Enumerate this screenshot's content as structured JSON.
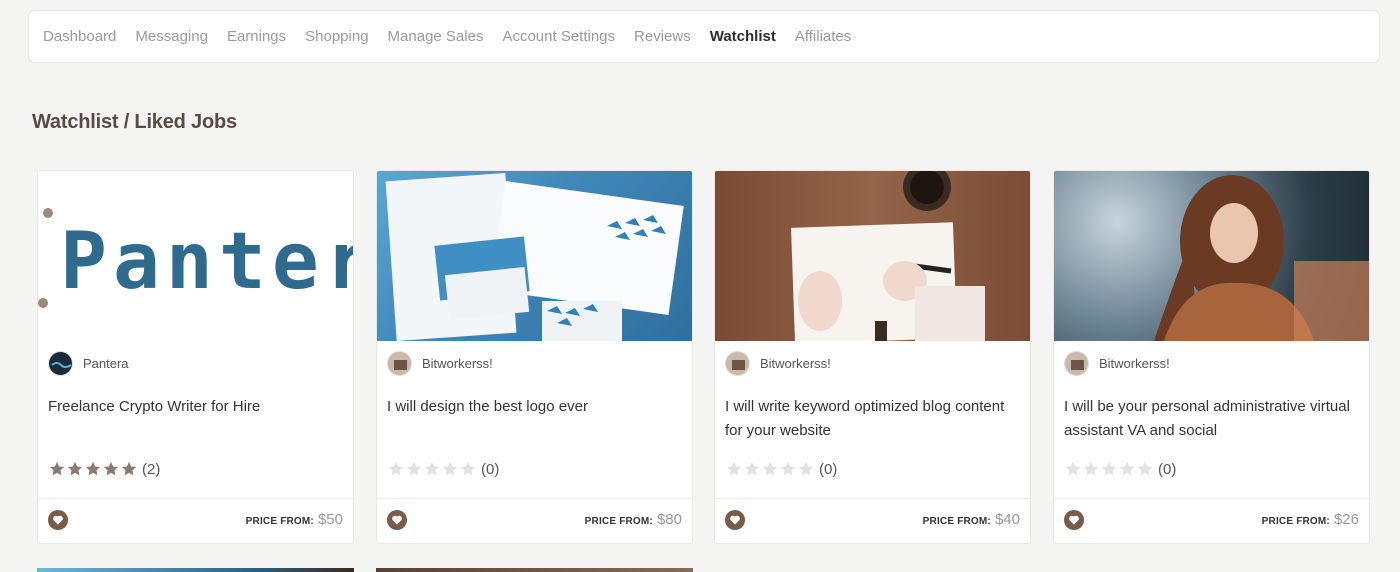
{
  "nav": {
    "items": [
      {
        "label": "Dashboard",
        "active": false
      },
      {
        "label": "Messaging",
        "active": false
      },
      {
        "label": "Earnings",
        "active": false
      },
      {
        "label": "Shopping",
        "active": false
      },
      {
        "label": "Manage Sales",
        "active": false
      },
      {
        "label": "Account Settings",
        "active": false
      },
      {
        "label": "Reviews",
        "active": false
      },
      {
        "label": "Watchlist",
        "active": true
      },
      {
        "label": "Affiliates",
        "active": false
      }
    ]
  },
  "page": {
    "title": "Watchlist / Liked Jobs"
  },
  "cards": [
    {
      "image": "pantera-logo-text",
      "image_text": "Panter",
      "seller": "Pantera",
      "title": "Freelance Crypto Writer for Hire",
      "rating": 5,
      "rating_count": "(2)",
      "price_label": "PRICE FROM:",
      "price": "$50"
    },
    {
      "image": "stationery-mockup",
      "seller": "Bitworkerss!",
      "title": "I will design the best logo ever",
      "rating": 0,
      "rating_count": "(0)",
      "price_label": "PRICE FROM:",
      "price": "$80"
    },
    {
      "image": "hand-writing-notebook",
      "seller": "Bitworkerss!",
      "title": "I will write keyword optimized blog content for your website",
      "rating": 0,
      "rating_count": "(0)",
      "price_label": "PRICE FROM:",
      "price": "$40"
    },
    {
      "image": "woman-portrait",
      "seller": "Bitworkerss!",
      "title": "I will be your personal administrative virtual assistant VA and social",
      "rating": 0,
      "rating_count": "(0)",
      "price_label": "PRICE FROM:",
      "price": "$26"
    }
  ],
  "colors": {
    "accent": "#7a5a48",
    "star_filled": "#8d7a6e",
    "star_empty": "#e2e2e2",
    "title": "#5a4a42"
  },
  "icons": {
    "favorite": "heart-icon",
    "rating": "star-icon"
  }
}
